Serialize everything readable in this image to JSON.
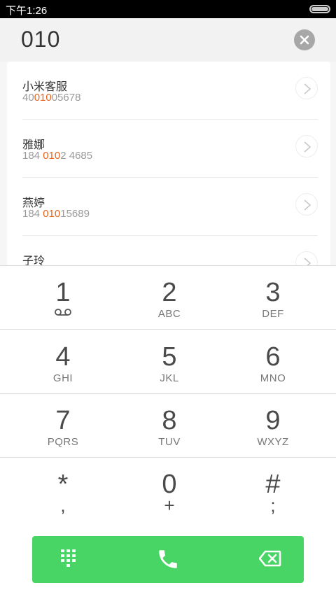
{
  "status_bar": {
    "time": "下午1:26"
  },
  "search": {
    "query": "010"
  },
  "results": [
    {
      "name": "小米客服",
      "number_parts": [
        "40",
        "010",
        "05678"
      ]
    },
    {
      "name": "雅娜",
      "number_parts": [
        "184 ",
        "010",
        "2 4685"
      ]
    },
    {
      "name": "燕婷",
      "number_parts": [
        "184 ",
        "010",
        "15689"
      ]
    },
    {
      "name": "子玲",
      "number_parts": [
        "",
        "",
        ""
      ]
    }
  ],
  "dialpad": {
    "keys": [
      {
        "digit": "1",
        "letters": ""
      },
      {
        "digit": "2",
        "letters": "ABC"
      },
      {
        "digit": "3",
        "letters": "DEF"
      },
      {
        "digit": "4",
        "letters": "GHI"
      },
      {
        "digit": "5",
        "letters": "JKL"
      },
      {
        "digit": "6",
        "letters": "MNO"
      },
      {
        "digit": "7",
        "letters": "PQRS"
      },
      {
        "digit": "8",
        "letters": "TUV"
      },
      {
        "digit": "9",
        "letters": "WXYZ"
      },
      {
        "digit": "*",
        "sub": ","
      },
      {
        "digit": "0",
        "sub": "+"
      },
      {
        "digit": "#",
        "sub": ";"
      }
    ]
  },
  "colors": {
    "highlight": "#e8641b",
    "call_green": "#49d466"
  },
  "icons": {
    "voicemail": "voicemail-icon",
    "keypad": "keypad-icon",
    "call": "phone-icon",
    "backspace": "backspace-icon"
  }
}
